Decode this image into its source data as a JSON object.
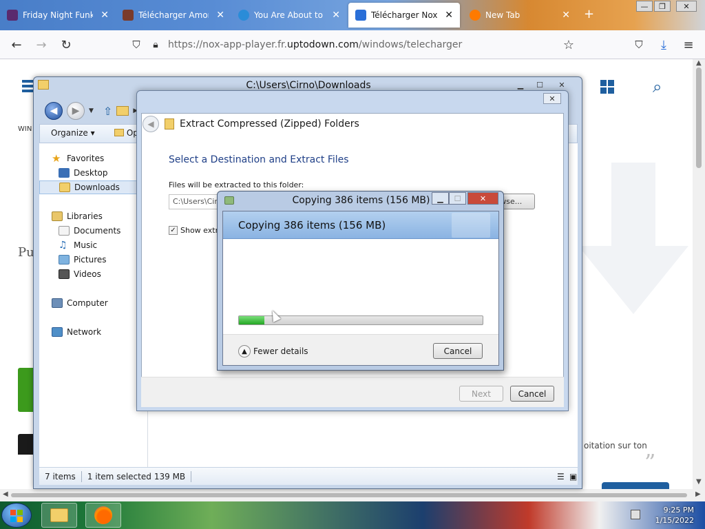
{
  "browser": {
    "tabs": [
      {
        "label": "Friday Night Funkin",
        "favicon_color": "#5a2a6e"
      },
      {
        "label": "Télécharger Among",
        "favicon_color": "#7a3b2a"
      },
      {
        "label": "You Are About to Do",
        "favicon_color": "#2a8cd8"
      },
      {
        "label": "Télécharger NoxPlay",
        "favicon_color": "#2a6fd8"
      },
      {
        "label": "New Tab",
        "favicon_color": "#ff7a00"
      }
    ],
    "url": {
      "prefix": "https://nox-app-player.fr.",
      "domain": "uptodown.com",
      "suffix": "/windows/telecharger"
    }
  },
  "webpage": {
    "win_text": "WIN",
    "pu_text": "Pu",
    "side_text": "oitation sur ton",
    "quote": "”"
  },
  "explorer": {
    "title": "C:\\Users\\Cirno\\Downloads",
    "organize": "Organize",
    "open_partial": "Op",
    "nav": {
      "favorites": "Favorites",
      "desktop": "Desktop",
      "downloads": "Downloads",
      "libraries": "Libraries",
      "documents": "Documents",
      "music": "Music",
      "pictures": "Pictures",
      "videos": "Videos",
      "computer": "Computer",
      "network": "Network"
    },
    "status": {
      "items": "7 items",
      "selected": "1 item selected",
      "size": "139 MB"
    }
  },
  "wizard": {
    "title": "Extract Compressed (Zipped) Folders",
    "heading": "Select a Destination and Extract Files",
    "files_label": "Files will be extracted to this folder:",
    "path": "C:\\Users\\Cirno\\Downloads",
    "browse": "Browse...",
    "show_label": "Show extracted files when complete",
    "next": "Next",
    "cancel": "Cancel"
  },
  "copy_dialog": {
    "title": "Copying 386 items (156 MB)",
    "banner": "Copying 386 items (156 MB)",
    "progress_fraction": 0.105,
    "fewer_details": "Fewer details",
    "cancel": "Cancel"
  },
  "taskbar": {
    "time": "9:25 PM",
    "date": "1/15/2022"
  }
}
